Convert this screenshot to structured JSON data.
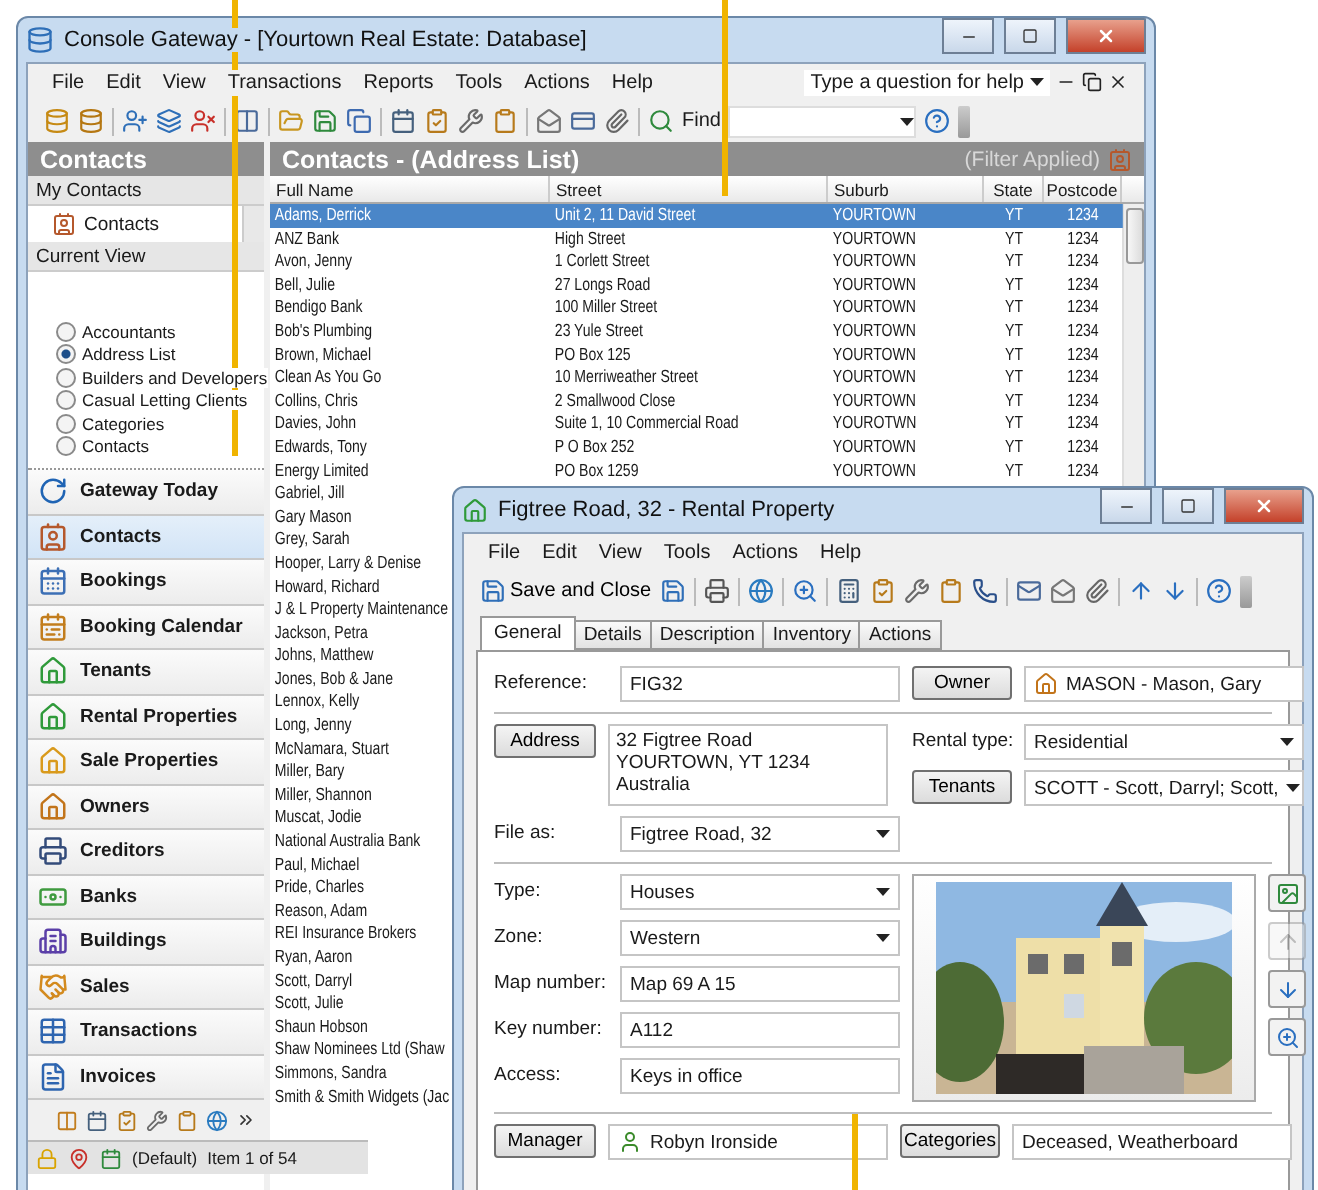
{
  "main_window": {
    "title": "Console Gateway - [Yourtown Real Estate: Database]",
    "menu": [
      "File",
      "Edit",
      "View",
      "Transactions",
      "Reports",
      "Tools",
      "Actions",
      "Help"
    ],
    "help_box": "Type a question for help",
    "find_label": "Find",
    "sidebar": {
      "title": "Contacts",
      "my_contacts_label": "My Contacts",
      "my_contacts": [
        {
          "label": "Contacts",
          "selected": false
        }
      ],
      "current_view_label": "Current View",
      "views": [
        {
          "label": "Accountants",
          "selected": false
        },
        {
          "label": "Address List",
          "selected": true
        },
        {
          "label": "Builders and Developers",
          "selected": false
        },
        {
          "label": "Casual Letting Clients",
          "selected": false
        },
        {
          "label": "Categories",
          "selected": false
        },
        {
          "label": "Contacts",
          "selected": false
        }
      ],
      "nav": [
        {
          "label": "Gateway Today",
          "kind": "today",
          "selected": false
        },
        {
          "label": "Contacts",
          "kind": "contacts",
          "selected": true
        },
        {
          "label": "Bookings",
          "kind": "bookings",
          "selected": false
        },
        {
          "label": "Booking Calendar",
          "kind": "calendar",
          "selected": false
        },
        {
          "label": "Tenants",
          "kind": "tenants",
          "selected": false
        },
        {
          "label": "Rental Properties",
          "kind": "rentals",
          "selected": false
        },
        {
          "label": "Sale Properties",
          "kind": "saleprops",
          "selected": false
        },
        {
          "label": "Owners",
          "kind": "owners",
          "selected": false
        },
        {
          "label": "Creditors",
          "kind": "creditors",
          "selected": false
        },
        {
          "label": "Banks",
          "kind": "banks",
          "selected": false
        },
        {
          "label": "Buildings",
          "kind": "buildings",
          "selected": false
        },
        {
          "label": "Sales",
          "kind": "sales",
          "selected": false
        },
        {
          "label": "Transactions",
          "kind": "transactions",
          "selected": false
        },
        {
          "label": "Invoices",
          "kind": "invoices",
          "selected": false
        }
      ],
      "status": {
        "profile": "(Default)",
        "count": "Item 1 of 54"
      }
    },
    "list": {
      "title": "Contacts - (Address List)",
      "filter": "(Filter Applied)",
      "columns": [
        "Full Name",
        "Street",
        "Suburb",
        "State",
        "Postcode"
      ],
      "rows": [
        {
          "name": "Adams, Derrick",
          "street": "Unit 2, 11 David Street",
          "suburb": "YOURTOWN",
          "state": "YT",
          "postcode": "1234",
          "selected": true
        },
        {
          "name": "ANZ Bank",
          "street": "High Street",
          "suburb": "YOURTOWN",
          "state": "YT",
          "postcode": "1234",
          "selected": false
        },
        {
          "name": "Avon, Jenny",
          "street": "1 Corlett Street",
          "suburb": "YOURTOWN",
          "state": "YT",
          "postcode": "1234",
          "selected": false
        },
        {
          "name": "Bell, Julie",
          "street": "27 Longs Road",
          "suburb": "YOURTOWN",
          "state": "YT",
          "postcode": "1234",
          "selected": false
        },
        {
          "name": "Bendigo Bank",
          "street": "100 Miller Street",
          "suburb": "YOURTOWN",
          "state": "YT",
          "postcode": "1234",
          "selected": false
        },
        {
          "name": "Bob's Plumbing",
          "street": "23 Yule Street",
          "suburb": "YOURTOWN",
          "state": "YT",
          "postcode": "1234",
          "selected": false
        },
        {
          "name": "Brown, Michael",
          "street": "PO Box 125",
          "suburb": "YOURTOWN",
          "state": "YT",
          "postcode": "1234",
          "selected": false
        },
        {
          "name": "Clean As You Go",
          "street": "10 Merriweather Street",
          "suburb": "YOURTOWN",
          "state": "YT",
          "postcode": "1234",
          "selected": false
        },
        {
          "name": "Collins, Chris",
          "street": "2 Smallwood Close",
          "suburb": "YOURTOWN",
          "state": "YT",
          "postcode": "1234",
          "selected": false
        },
        {
          "name": "Davies, John",
          "street": "Suite 1, 10 Commercial Road",
          "suburb": "YOUROTWN",
          "state": "YT",
          "postcode": "1234",
          "selected": false
        },
        {
          "name": "Edwards, Tony",
          "street": "P O Box 252",
          "suburb": "YOURTOWN",
          "state": "YT",
          "postcode": "1234",
          "selected": false
        },
        {
          "name": "Energy Limited",
          "street": "PO Box 1259",
          "suburb": "YOURTOWN",
          "state": "YT",
          "postcode": "1234",
          "selected": false
        },
        {
          "name": "Gabriel, Jill",
          "selected": false
        },
        {
          "name": "Gary Mason",
          "selected": false
        },
        {
          "name": "Grey, Sarah",
          "selected": false
        },
        {
          "name": "Hooper, Larry & Denise",
          "selected": false
        },
        {
          "name": "Howard, Richard",
          "selected": false
        },
        {
          "name": "J & L Property Maintenance",
          "selected": false
        },
        {
          "name": "Jackson, Petra",
          "selected": false
        },
        {
          "name": "Johns, Matthew",
          "selected": false
        },
        {
          "name": "Jones, Bob & Jane",
          "selected": false
        },
        {
          "name": "Lennox, Kelly",
          "selected": false
        },
        {
          "name": "Long, Jenny",
          "selected": false
        },
        {
          "name": "McNamara, Stuart",
          "selected": false
        },
        {
          "name": "Miller, Bary",
          "selected": false
        },
        {
          "name": "Miller, Shannon",
          "selected": false
        },
        {
          "name": "Muscat, Jodie",
          "selected": false
        },
        {
          "name": "National Australia Bank",
          "selected": false
        },
        {
          "name": "Paul, Michael",
          "selected": false
        },
        {
          "name": "Pride, Charles",
          "selected": false
        },
        {
          "name": "Reason, Adam",
          "selected": false
        },
        {
          "name": "REI Insurance Brokers",
          "selected": false
        },
        {
          "name": "Ryan, Aaron",
          "selected": false
        },
        {
          "name": "Scott, Darryl",
          "selected": false
        },
        {
          "name": "Scott, Julie",
          "selected": false
        },
        {
          "name": "Shaun Hobson",
          "selected": false
        },
        {
          "name": "Shaw Nominees Ltd (Shaw",
          "selected": false
        },
        {
          "name": "Simmons, Sandra",
          "selected": false
        },
        {
          "name": "Smith & Smith Widgets (Jac",
          "selected": false
        }
      ]
    }
  },
  "property_window": {
    "title": "Figtree Road, 32 - Rental Property",
    "menu": [
      "File",
      "Edit",
      "View",
      "Tools",
      "Actions",
      "Help"
    ],
    "save_button": "Save and Close",
    "tabs": [
      {
        "label": "General",
        "selected": true
      },
      {
        "label": "Details",
        "selected": false
      },
      {
        "label": "Description",
        "selected": false
      },
      {
        "label": "Inventory",
        "selected": false
      },
      {
        "label": "Actions",
        "selected": false
      }
    ],
    "reference": {
      "label": "Reference:",
      "value": "FIG32"
    },
    "owner": {
      "button": "Owner",
      "value": "MASON - Mason, Gary"
    },
    "address": {
      "button": "Address",
      "lines": [
        "32 Figtree Road",
        "YOURTOWN, YT  1234",
        "Australia"
      ]
    },
    "rental_type": {
      "label": "Rental type:",
      "value": "Residential"
    },
    "tenants": {
      "button": "Tenants",
      "value": "SCOTT - Scott, Darryl; Scott,"
    },
    "file_as": {
      "label": "File as:",
      "value": "Figtree Road, 32"
    },
    "details": [
      {
        "label": "Type:",
        "value": "Houses",
        "kind": "select"
      },
      {
        "label": "Zone:",
        "value": "Western",
        "kind": "select"
      },
      {
        "label": "Map number:",
        "value": "Map 69 A 15",
        "kind": "input"
      },
      {
        "label": "Key number:",
        "value": "A112",
        "kind": "input"
      },
      {
        "label": "Access:",
        "value": "Keys in office",
        "kind": "input"
      }
    ],
    "manager": {
      "button": "Manager",
      "value": "Robyn Ironside"
    },
    "categories": {
      "button": "Categories",
      "value": "Deceased, Weatherboard"
    }
  }
}
